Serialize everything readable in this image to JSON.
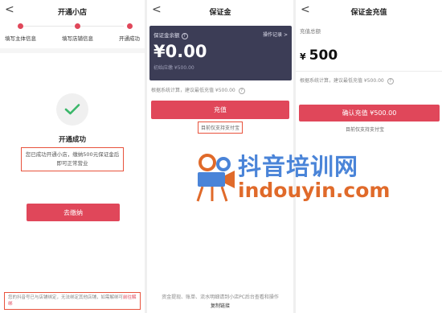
{
  "screen1": {
    "title": "开通小店",
    "back_glyph": "<",
    "steps": [
      {
        "label": "填写主体信息"
      },
      {
        "label": "填写店铺信息"
      },
      {
        "label": "开通成功"
      }
    ],
    "success_title": "开通成功",
    "success_desc": "您已成功开通小店，缴纳500元保证金后即可正常营业",
    "pay_button": "去缴纳",
    "bottom_note": "您的抖音号已与店铺绑定，无法绑定其他店铺，如需解绑可",
    "bottom_link": "前往解绑"
  },
  "screen2": {
    "title": "保证金",
    "back_glyph": "<",
    "card_label": "保证金余额",
    "card_help": "?",
    "card_link": "操作记录 >",
    "card_amount": "¥0.00",
    "card_initial": "初始应缴 ¥500.00",
    "hint": "根据系统计算，建议最低充值 ¥500.00",
    "hint_help": "?",
    "recharge_button": "充值",
    "pay_note": "目前仅支持支付宝",
    "bottom_text": "资金提现、账单、流水明细请到小店PC后台查看和操作",
    "bottom_link": "复制链接"
  },
  "screen3": {
    "title": "保证金充值",
    "back_glyph": "<",
    "total_label": "充值总额",
    "currency": "¥",
    "total_value": "500",
    "hint": "根据系统计算，建议最低充值 ¥500.00",
    "hint_help": "?",
    "confirm_button": "确认充值 ¥500.00",
    "pay_note": "目前仅支持支付宝"
  },
  "watermark": {
    "text_cn": "抖音培训网",
    "text_en": "indouyin.com"
  },
  "colors": {
    "accent": "#e0475a",
    "annotation": "#e8533d",
    "card": "#3c3d56",
    "watermark_blue": "#4a84d8",
    "watermark_orange": "#e06a2a"
  }
}
